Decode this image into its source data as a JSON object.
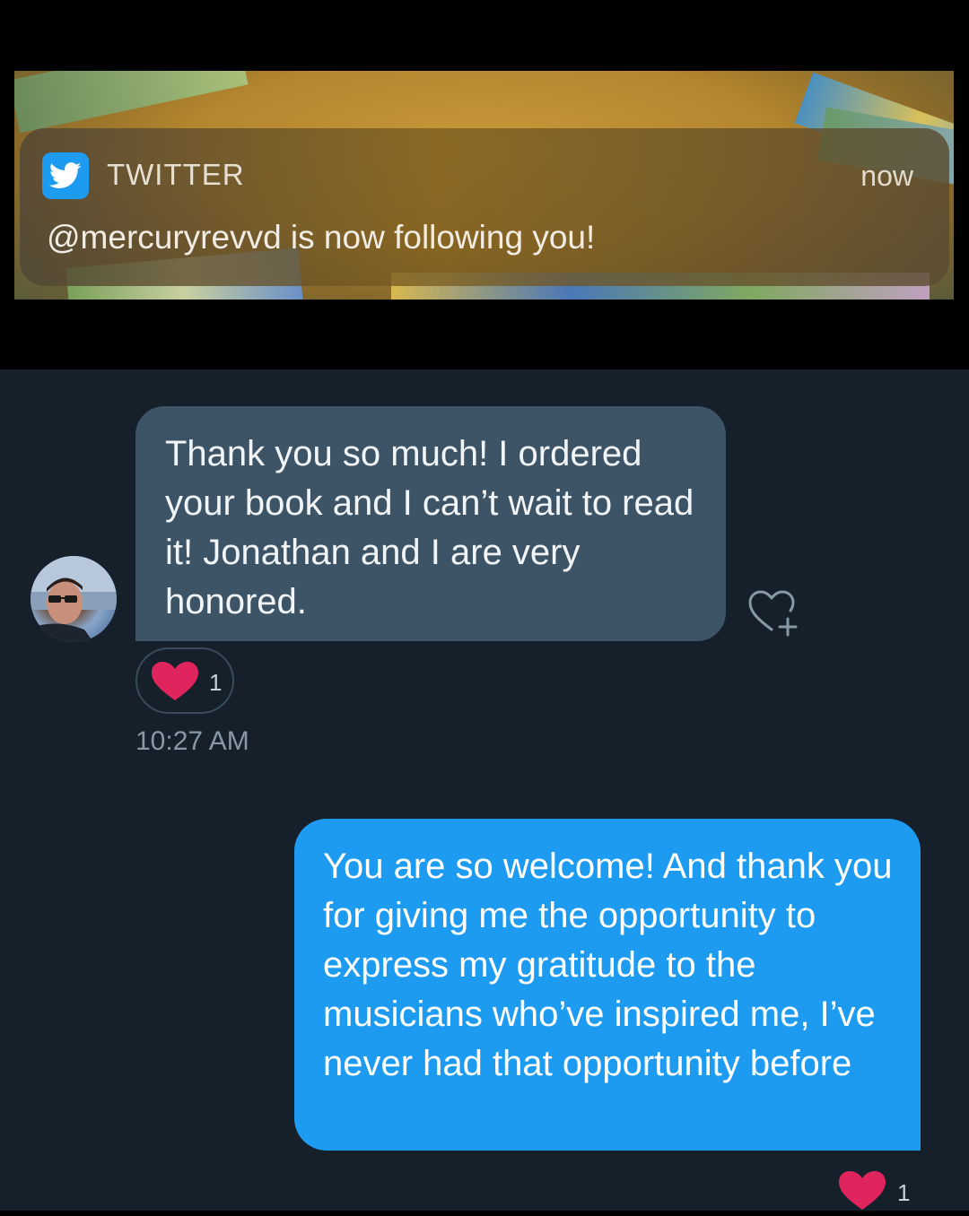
{
  "notification": {
    "app_name": "TWITTER",
    "time": "now",
    "message": "@mercuryrevvd is now following you!",
    "icon": "twitter-bird-icon",
    "accent": "#1d9bf0"
  },
  "conversation": {
    "incoming": {
      "text": "Thank you so much! I ordered your book and I can’t wait to read it! Jonathan and I are very honored.",
      "reaction_count": "1",
      "timestamp": "10:27 AM"
    },
    "outgoing": {
      "text": "You are so welcome! And thank you for giving me the opportunity to express my gratitude to the musicians who’ve inspired me, I’ve never had that opportunity before",
      "reaction_count": "1"
    },
    "colors": {
      "background": "#15202b",
      "incoming_bubble": "#3d5466",
      "outgoing_bubble": "#1d9bf0",
      "heart": "#e0245e"
    }
  }
}
